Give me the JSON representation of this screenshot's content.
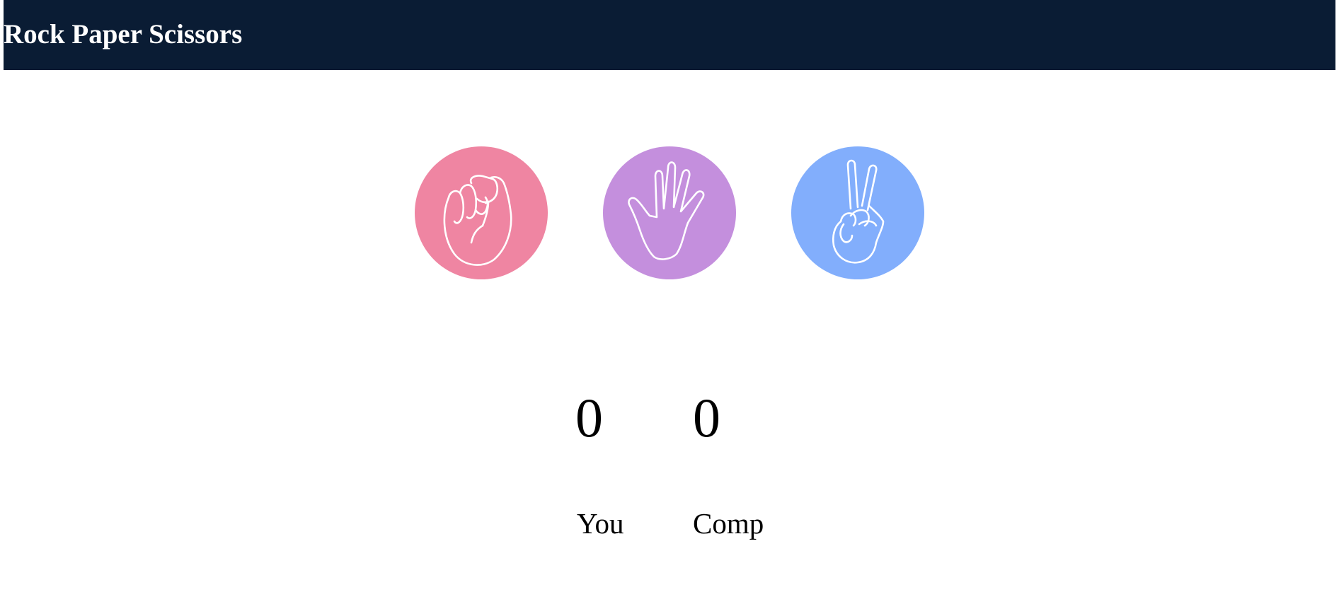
{
  "header": {
    "title": "Rock Paper Scissors"
  },
  "choices": [
    {
      "id": "rock",
      "icon": "fist-icon",
      "color": "#ef85a2"
    },
    {
      "id": "paper",
      "icon": "open-hand-icon",
      "color": "#c48fdd"
    },
    {
      "id": "scissors",
      "icon": "peace-hand-icon",
      "color": "#82aefc"
    }
  ],
  "scoreboard": {
    "user_score": "0",
    "comp_score": "0",
    "user_label": "You",
    "comp_label": "Comp"
  },
  "colors": {
    "header_bg": "#0a1c34",
    "rock": "#ef85a2",
    "paper": "#c48fdd",
    "scissors": "#82aefc"
  }
}
